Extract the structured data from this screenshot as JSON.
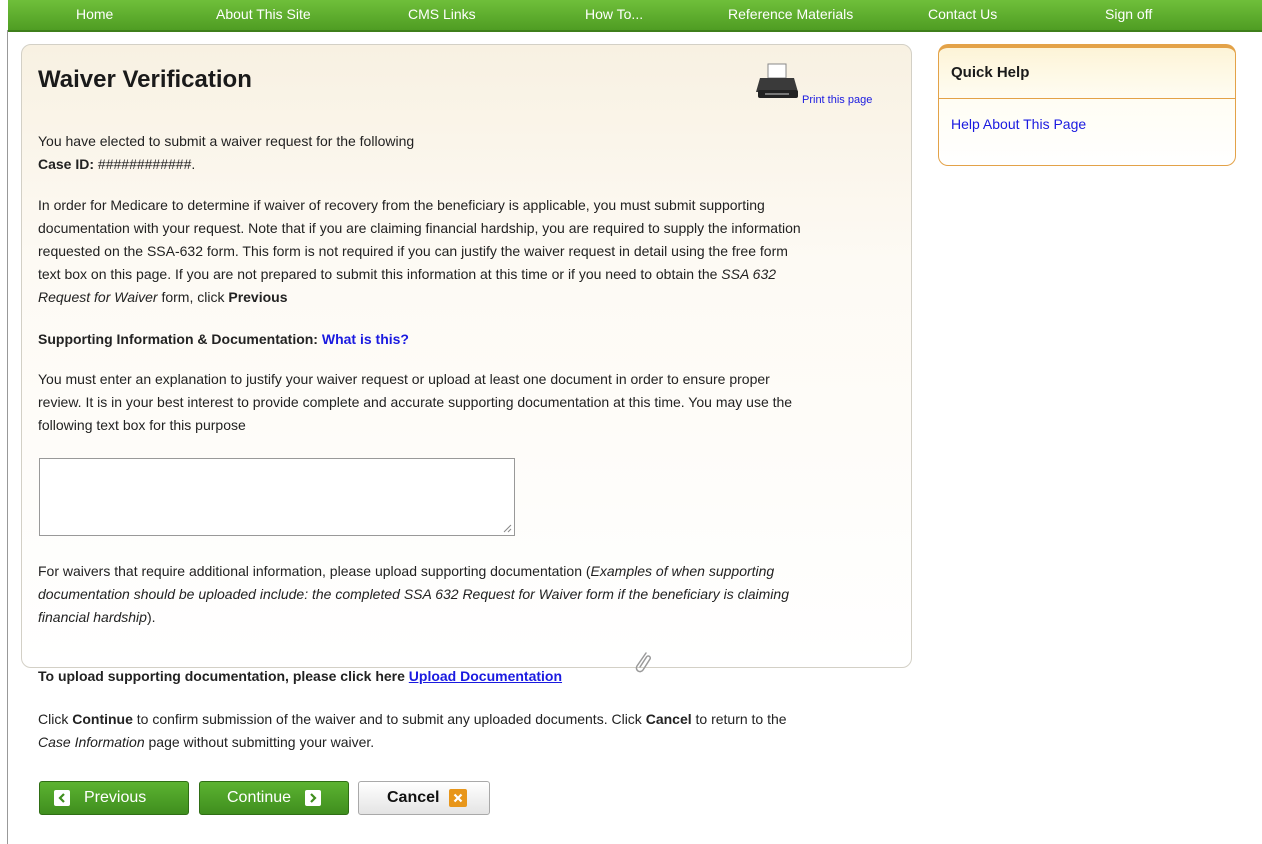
{
  "nav": {
    "items": [
      "Home",
      "About This Site",
      "CMS Links",
      "How To...",
      "Reference Materials",
      "Contact Us",
      "Sign off"
    ]
  },
  "main": {
    "title": "Waiver Verification",
    "print_label": "Print this page",
    "intro_line": "You have elected to submit a waiver request for the following",
    "case_id_label": "Case ID:",
    "case_id_value": "############.",
    "para1_lines": [
      "In order for Medicare to determine if waiver of recovery from the beneficiary is applicable, you must submit supporting",
      "documentation with your request. Note that if you are claiming financial hardship, you are required to supply the information",
      "requested on the SSA-632 form. This form is not required if you can justify the waiver request in detail using the free form",
      "text box on this page. If you are not prepared to submit this information at this time or if you need to obtain the"
    ],
    "para1_form_name_a": "SSA 632",
    "para1_form_name_b": "Request for Waiver",
    "para1_tail": "form, click",
    "para1_previous": "Previous",
    "supporting_label": "Supporting Information & Documentation:",
    "what_is_this": "What is this?",
    "para2_lines": [
      "You must enter an explanation to justify your waiver request or upload at least one document in order to ensure proper",
      "review. It is in your best interest to provide complete and accurate supporting documentation at this time. You may use the",
      "following text box for this purpose"
    ],
    "explanation_value": "",
    "para3_start": "For waivers that require additional information, please upload supporting documentation (",
    "para3_italic_1": "Examples of when supporting",
    "para3_italic_2": "documentation should be uploaded include: the completed SSA 632 Request for Waiver form if the beneficiary is claiming",
    "para3_italic_3": "financial hardship",
    "para3_end": ").",
    "upload_prompt": "To upload supporting documentation, please click here",
    "upload_link": "Upload Documentation",
    "confirm_1a": "Click",
    "confirm_continue": "Continue",
    "confirm_1b": "to confirm submission of the waiver and to submit any uploaded documents. Click",
    "confirm_cancel": "Cancel",
    "confirm_1c": "to return to the",
    "confirm_case_info": "Case Information",
    "confirm_2": "page without submitting your waiver."
  },
  "buttons": {
    "previous": "Previous",
    "continue": "Continue",
    "cancel": "Cancel"
  },
  "quick_help": {
    "title": "Quick Help",
    "link": "Help About This Page"
  },
  "colors": {
    "nav_green": "#5aad2d",
    "link_blue": "#1a1ae0",
    "help_orange": "#e3a248",
    "cancel_orange": "#e8961a"
  }
}
